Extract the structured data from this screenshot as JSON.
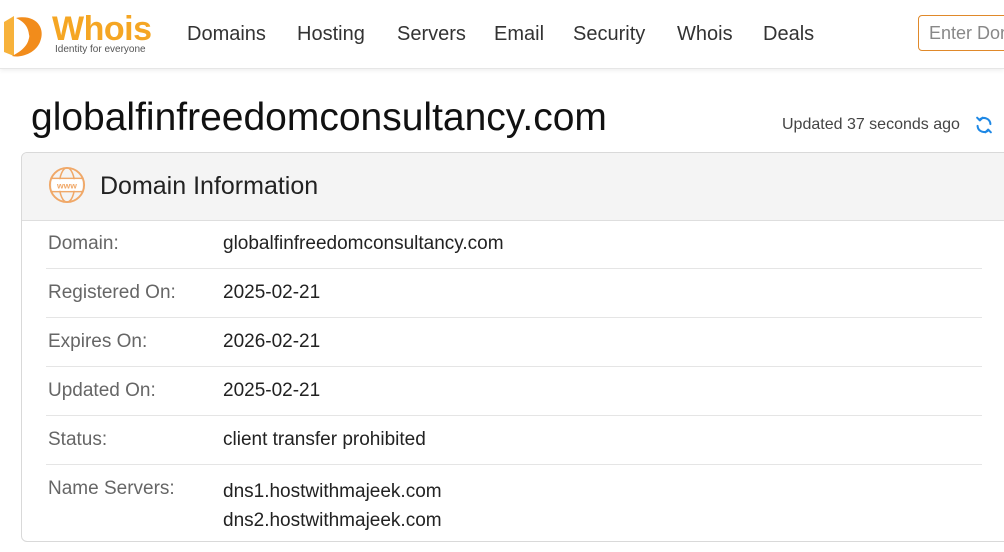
{
  "header": {
    "logo_word": "Whois",
    "logo_tagline": "Identity for everyone",
    "nav": [
      "Domains",
      "Hosting",
      "Servers",
      "Email",
      "Security",
      "Whois",
      "Deals"
    ],
    "search_placeholder": "Enter Domain or IP"
  },
  "page": {
    "domain_title": "globalfinfreedomconsultancy.com",
    "updated_text": "Updated 37 seconds ago"
  },
  "domain_info": {
    "title": "Domain Information",
    "rows": [
      {
        "label": "Domain:",
        "value": "globalfinfreedomconsultancy.com"
      },
      {
        "label": "Registered On:",
        "value": "2025-02-21"
      },
      {
        "label": "Expires On:",
        "value": "2026-02-21"
      },
      {
        "label": "Updated On:",
        "value": "2025-02-21"
      },
      {
        "label": "Status:",
        "value": "client transfer prohibited"
      },
      {
        "label": "Name Servers:",
        "values": [
          "dns1.hostwithmajeek.com",
          "dns2.hostwithmajeek.com"
        ]
      }
    ]
  },
  "colors": {
    "brand_orange": "#f5a623",
    "accent_blue": "#1e88e5"
  }
}
